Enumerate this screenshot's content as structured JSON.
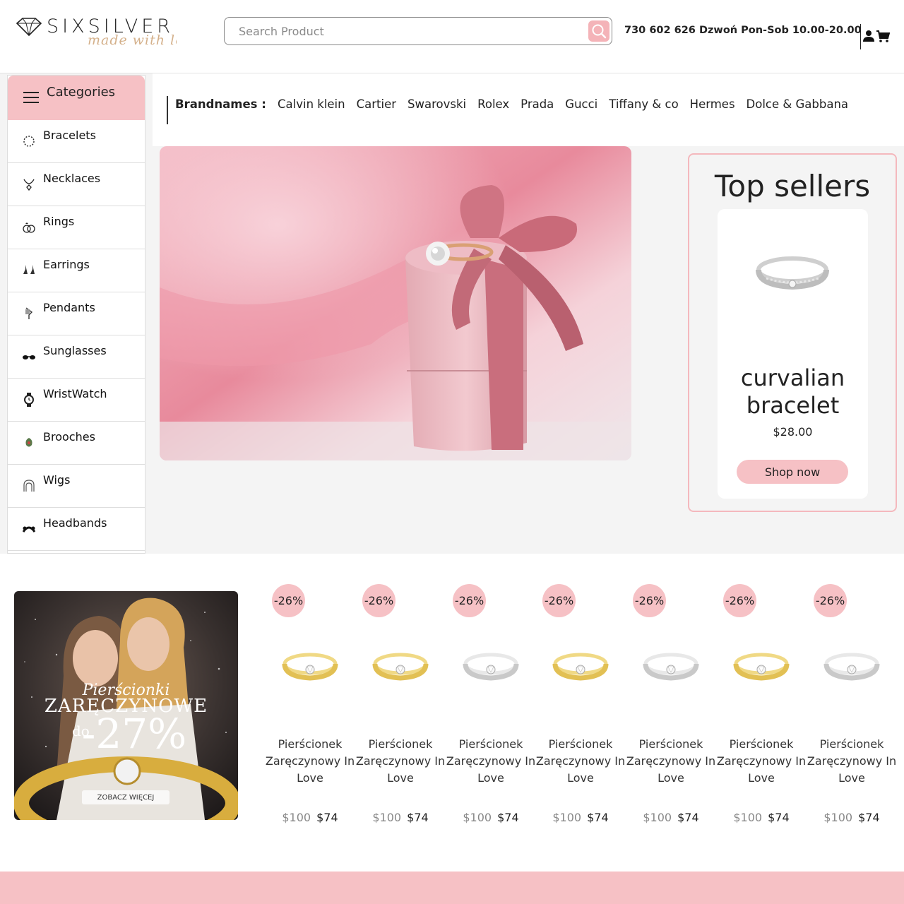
{
  "header": {
    "logo_text": "SIXSILVER",
    "logo_script": "made with love",
    "search_placeholder": "Search Product",
    "phone": "730 602 626 Dzwoń Pon-Sob 10.00-20.00",
    "icons": [
      "search-icon",
      "user-icon",
      "cart-icon"
    ]
  },
  "categories": {
    "title": "Categories",
    "items": [
      {
        "label": "Bracelets",
        "icon": "bracelet-icon"
      },
      {
        "label": "Necklaces",
        "icon": "necklace-icon"
      },
      {
        "label": "Rings",
        "icon": "rings-icon"
      },
      {
        "label": "Earrings",
        "icon": "earrings-icon"
      },
      {
        "label": "Pendants",
        "icon": "pendant-icon"
      },
      {
        "label": "Sunglasses",
        "icon": "sunglasses-icon"
      },
      {
        "label": "WristWatch",
        "icon": "watch-icon"
      },
      {
        "label": "Brooches",
        "icon": "brooch-icon"
      },
      {
        "label": "Wigs",
        "icon": "wig-icon"
      },
      {
        "label": "Headbands",
        "icon": "headband-icon"
      }
    ]
  },
  "brands": {
    "label": "Brandnames :",
    "items": [
      "Calvin klein",
      "Cartier",
      "Swarovski",
      "Rolex",
      "Prada",
      "Gucci",
      "Tiffany & co",
      "Hermes",
      "Dolce & Gabbana"
    ]
  },
  "top_sellers": {
    "title": "Top sellers",
    "product_name": "curvalian bracelet",
    "price": "$28.00",
    "button": "Shop now"
  },
  "promo": {
    "line1": "Pierścionki",
    "line2": "ZARĘCZYNOWE",
    "line3_prefix": "do",
    "line3_value": "-27%",
    "button": "ZOBACZ WIĘCEJ"
  },
  "products": [
    {
      "badge": "-26%",
      "name": "Pierścionek Zaręczynowy In Love",
      "old_price": "$100",
      "price": "$74",
      "metal": "gold"
    },
    {
      "badge": "-26%",
      "name": "Pierścionek Zaręczynowy In Love",
      "old_price": "$100",
      "price": "$74",
      "metal": "gold"
    },
    {
      "badge": "-26%",
      "name": "Pierścionek Zaręczynowy In Love",
      "old_price": "$100",
      "price": "$74",
      "metal": "silver"
    },
    {
      "badge": "-26%",
      "name": "Pierścionek Zaręczynowy In Love",
      "old_price": "$100",
      "price": "$74",
      "metal": "gold"
    },
    {
      "badge": "-26%",
      "name": "Pierścionek Zaręczynowy In Love",
      "old_price": "$100",
      "price": "$74",
      "metal": "silver"
    },
    {
      "badge": "-26%",
      "name": "Pierścionek Zaręczynowy In Love",
      "old_price": "$100",
      "price": "$74",
      "metal": "gold"
    },
    {
      "badge": "-26%",
      "name": "Pierścionek Zaręczynowy In Love",
      "old_price": "$100",
      "price": "$74",
      "metal": "silver"
    }
  ],
  "colors": {
    "accent_pink": "#f6c1c5",
    "border_pink": "#f4b8bd",
    "gold": "#e7c65a",
    "silver": "#c8c8c8"
  }
}
